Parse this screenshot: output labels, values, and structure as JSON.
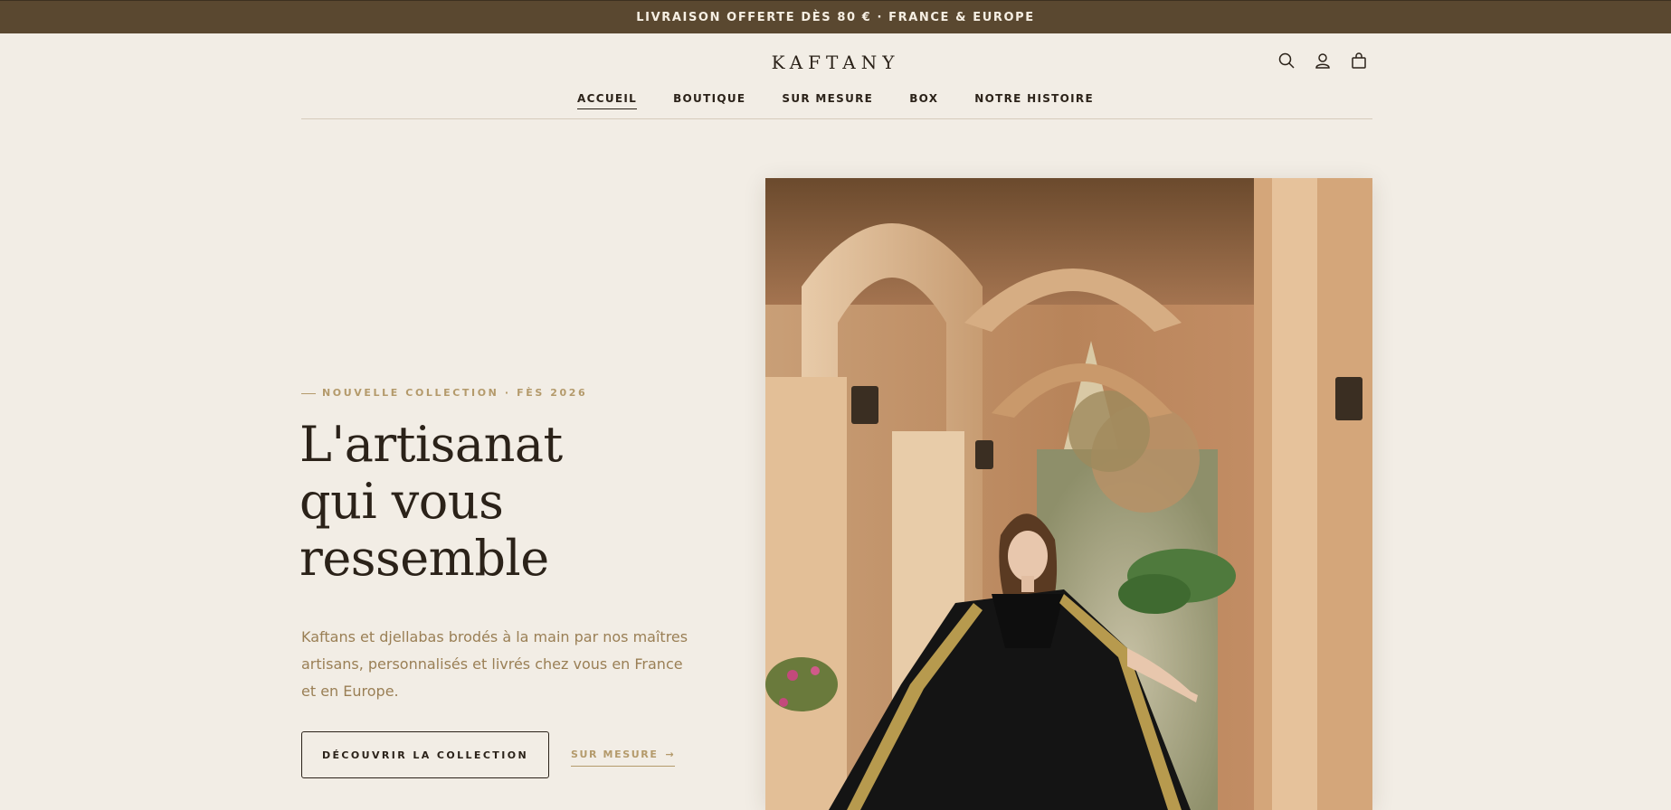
{
  "announcement": {
    "text": "LIVRAISON OFFERTE DÈS 80 € · FRANCE & EUROPE"
  },
  "header": {
    "logo": "KAFTANY",
    "icons": [
      "search-icon",
      "account-icon",
      "cart-icon"
    ]
  },
  "nav": {
    "items": [
      {
        "label": "ACCUEIL",
        "active": true
      },
      {
        "label": "BOUTIQUE"
      },
      {
        "label": "SUR MESURE"
      },
      {
        "label": "BOX"
      },
      {
        "label": "NOTRE HISTOIRE"
      }
    ]
  },
  "hero": {
    "eyebrow": "NOUVELLE COLLECTION · FÈS 2026",
    "title_lines": [
      "L'artisanat",
      "qui vous",
      "ressemble"
    ],
    "description": "Kaftans et djellabas brodés à la main par nos maîtres artisans, personnalisés et livrés chez vous en France et en Europe.",
    "primary_button": "DÉCOUVRIR LA COLLECTION",
    "secondary_link": "SUR MESURE",
    "secondary_arrow": "→"
  },
  "colors": {
    "background": "#f2ede5",
    "topbar": "#5a4830",
    "accent_gold": "#b49a6b",
    "text_dark": "#2b2219"
  }
}
